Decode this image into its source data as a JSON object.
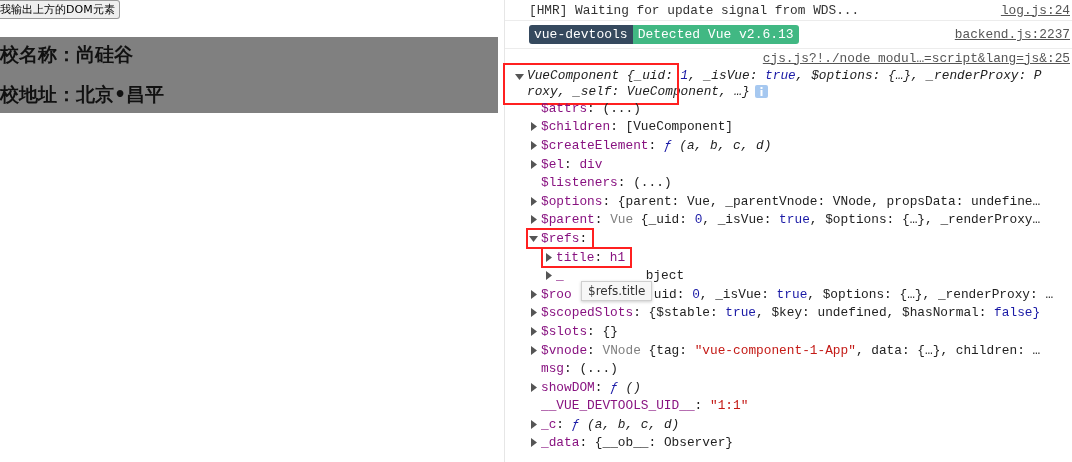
{
  "page": {
    "button": "我输出上方的DOM元素",
    "headings": [
      "校名称：尚硅谷",
      "校地址：北京•昌平"
    ]
  },
  "console": {
    "log": {
      "text": "[HMR] Waiting for update signal from WDS...",
      "source": "log.js:24"
    },
    "banner": {
      "badges": [
        {
          "label": "vue-devtools",
          "color": "#35495e"
        },
        {
          "label": "Detected Vue v2.6.13",
          "color": "#41b883"
        }
      ],
      "source": "backend.js:2237"
    },
    "object": {
      "source": "cjs.js?!./node_modul…=script&lang=js&:25",
      "expanded": true,
      "highlighted": true,
      "summary_lines": [
        [
          {
            "t": "VueComponent {_uid: ",
            "kind": "plain"
          },
          {
            "t": "1",
            "kind": "keyword"
          },
          {
            "t": ", _isVue: ",
            "kind": "plain"
          },
          {
            "t": "true",
            "kind": "keyword"
          },
          {
            "t": ", $options: {…}, _renderProxy: P",
            "kind": "plain"
          }
        ],
        [
          {
            "t": "roxy, _self: VueComponent, …}",
            "kind": "plain"
          }
        ]
      ],
      "children": [
        {
          "key": "$attrs",
          "colon": ":",
          "expandable": false,
          "value": [
            {
              "t": "(...)",
              "kind": "plain"
            }
          ]
        },
        {
          "key": "$children",
          "colon": ":",
          "expandable": true,
          "expanded": false,
          "value": [
            {
              "t": "[VueComponent]",
              "kind": "plain"
            }
          ]
        },
        {
          "key": "$createElement",
          "colon": ":",
          "expandable": true,
          "expanded": false,
          "value": [
            {
              "t": "ƒ",
              "kind": "func"
            },
            {
              "t": " (a, b, c, d)",
              "kind": "args"
            }
          ]
        },
        {
          "key": "$el",
          "colon": ":",
          "expandable": true,
          "expanded": false,
          "value": [
            {
              "t": "div",
              "kind": "tag"
            }
          ]
        },
        {
          "key": "$listeners",
          "colon": ":",
          "expandable": false,
          "value": [
            {
              "t": "(...)",
              "kind": "plain"
            }
          ]
        },
        {
          "key": "$options",
          "colon": ":",
          "expandable": true,
          "expanded": false,
          "value": [
            {
              "t": "{parent: Vue, _parentVnode: VNode, propsData: undefine…",
              "kind": "plain"
            }
          ]
        },
        {
          "key": "$parent",
          "colon": ":",
          "expandable": true,
          "expanded": false,
          "value": [
            {
              "t": "Vue",
              "kind": "grey"
            },
            {
              "t": " {_uid: ",
              "kind": "plain"
            },
            {
              "t": "0",
              "kind": "keyword"
            },
            {
              "t": ", _isVue: ",
              "kind": "plain"
            },
            {
              "t": "true",
              "kind": "keyword"
            },
            {
              "t": ", $options: {…}, _renderProxy…",
              "kind": "plain"
            }
          ]
        },
        {
          "key": "$refs",
          "colon": ":",
          "expandable": true,
          "expanded": true,
          "highlighted": true,
          "children": [
            {
              "key": "title",
              "colon": ":",
              "expandable": true,
              "expanded": false,
              "highlighted": true,
              "value": [
                {
                  "t": "h1",
                  "kind": "tag"
                }
              ],
              "tooltip": "$refs.title"
            },
            {
              "key": "_",
              "expandable": true,
              "expanded": false,
              "occluded": true,
              "value": [
                {
                  "t": "bject",
                  "kind": "plain"
                }
              ]
            }
          ]
        },
        {
          "key": "$roo",
          "expandable": true,
          "expanded": false,
          "occluded": true,
          "value": [
            {
              "t": "uid: ",
              "kind": "plain"
            },
            {
              "t": "0",
              "kind": "keyword"
            },
            {
              "t": ", _isVue: ",
              "kind": "plain"
            },
            {
              "t": "true",
              "kind": "keyword"
            },
            {
              "t": ", $options: {…}, _renderProxy: …",
              "kind": "plain"
            }
          ]
        },
        {
          "key": "$scopedSlots",
          "colon": ":",
          "expandable": true,
          "expanded": false,
          "value": [
            {
              "t": "{$stable: ",
              "kind": "plain"
            },
            {
              "t": "true",
              "kind": "keyword"
            },
            {
              "t": ", $key: undefined, $hasNormal: ",
              "kind": "plain"
            },
            {
              "t": "false}",
              "kind": "keyword"
            }
          ]
        },
        {
          "key": "$slots",
          "colon": ":",
          "expandable": true,
          "expanded": false,
          "value": [
            {
              "t": "{}",
              "kind": "plain"
            }
          ]
        },
        {
          "key": "$vnode",
          "colon": ":",
          "expandable": true,
          "expanded": false,
          "value": [
            {
              "t": "VNode",
              "kind": "grey"
            },
            {
              "t": " {tag: ",
              "kind": "plain"
            },
            {
              "t": "\"vue-component-1-App\"",
              "kind": "string"
            },
            {
              "t": ", data: {…}, children: …",
              "kind": "plain"
            }
          ]
        },
        {
          "key": "msg",
          "colon": ":",
          "expandable": false,
          "value": [
            {
              "t": "(...)",
              "kind": "plain"
            }
          ]
        },
        {
          "key": "showDOM",
          "colon": ":",
          "expandable": true,
          "expanded": false,
          "value": [
            {
              "t": "ƒ",
              "kind": "func"
            },
            {
              "t": " ()",
              "kind": "args"
            }
          ]
        },
        {
          "key": "__VUE_DEVTOOLS_UID__",
          "colon": ":",
          "expandable": false,
          "value": [
            {
              "t": "\"1:1\"",
              "kind": "string"
            }
          ]
        },
        {
          "key": "_c",
          "colon": ":",
          "expandable": true,
          "expanded": false,
          "value": [
            {
              "t": "ƒ",
              "kind": "func"
            },
            {
              "t": " (a, b, c, d)",
              "kind": "args"
            }
          ]
        },
        {
          "key": "_data",
          "colon": ":",
          "expandable": true,
          "expanded": false,
          "value": [
            {
              "t": "{__ob__: Observer}",
              "kind": "plain"
            }
          ]
        }
      ]
    }
  }
}
